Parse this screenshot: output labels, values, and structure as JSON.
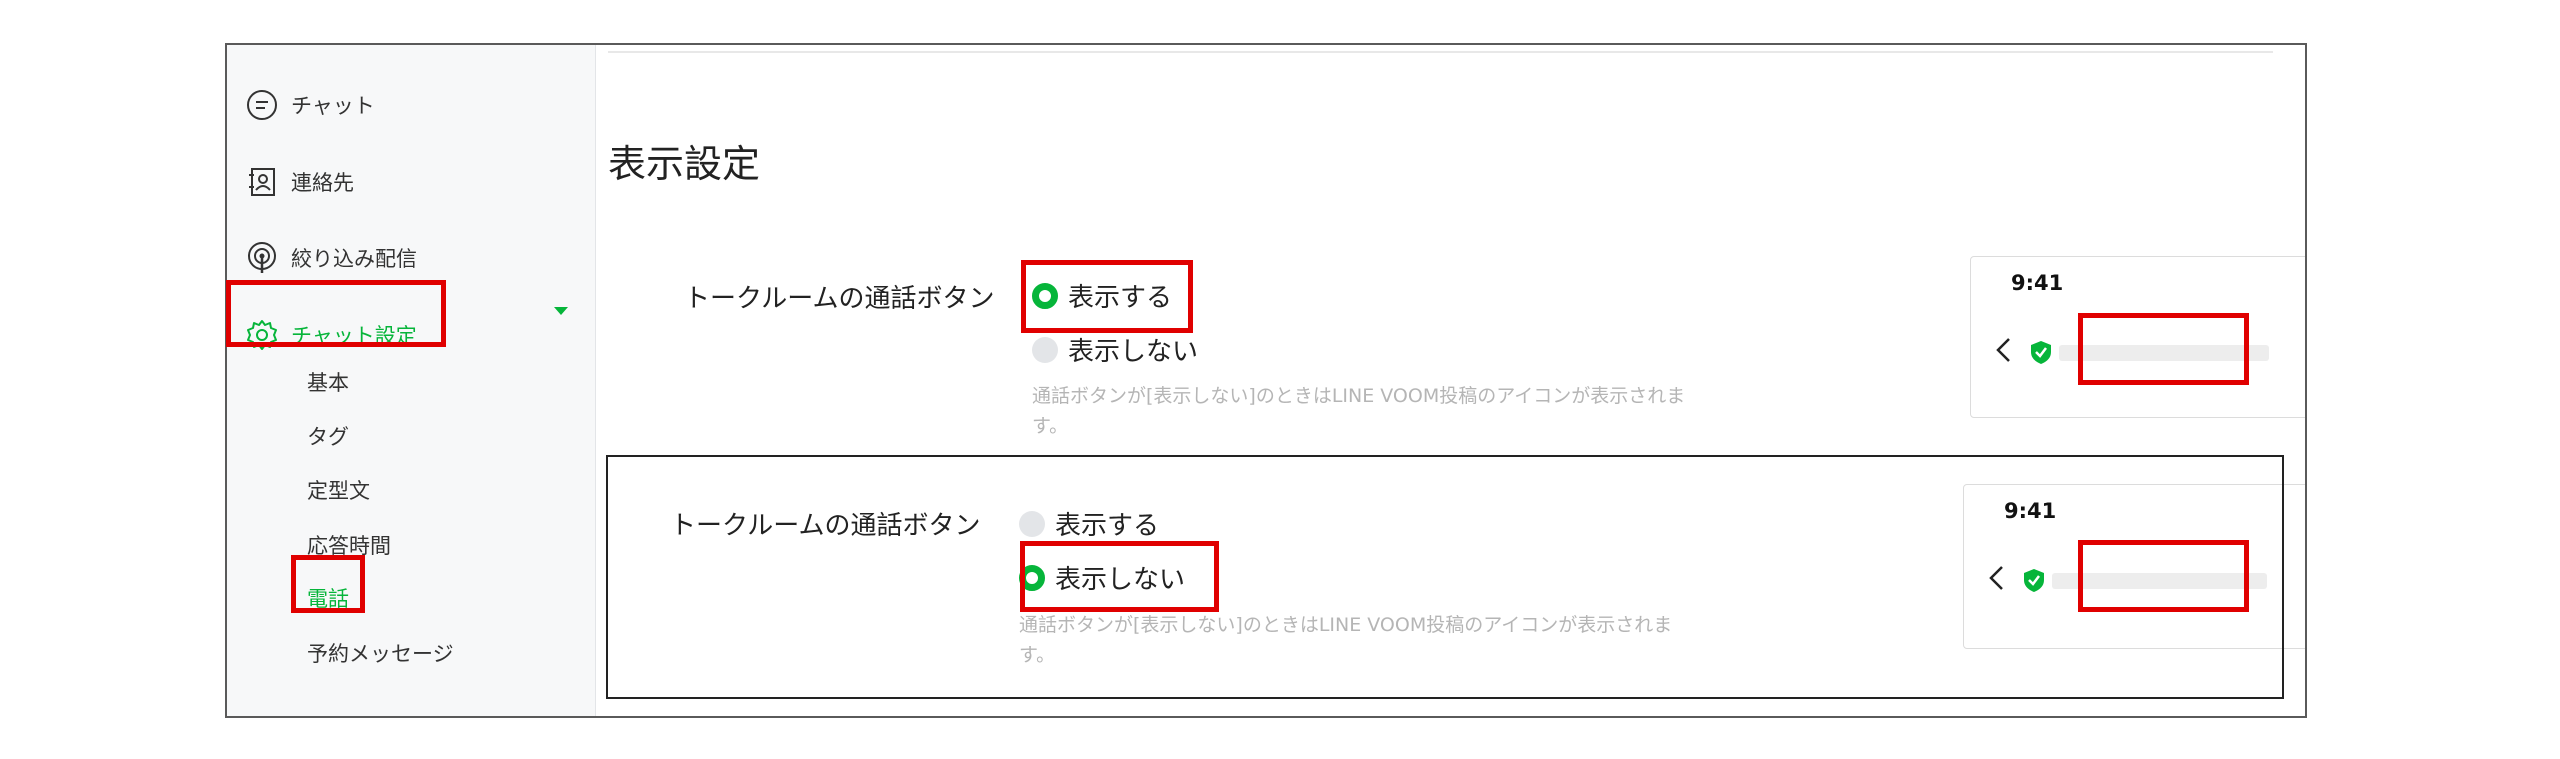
{
  "sidebar": {
    "items": [
      {
        "label": "チャット",
        "icon": "chat-bubble-icon"
      },
      {
        "label": "連絡先",
        "icon": "contact-book-icon"
      },
      {
        "label": "絞り込み配信",
        "icon": "broadcast-icon"
      },
      {
        "label": "チャット設定",
        "icon": "gear-icon",
        "active": true
      }
    ],
    "sub_items": [
      {
        "label": "基本"
      },
      {
        "label": "タグ"
      },
      {
        "label": "定型文"
      },
      {
        "label": "応答時間"
      },
      {
        "label": "電話",
        "active": true
      },
      {
        "label": "予約メッセージ"
      }
    ]
  },
  "main": {
    "title": "表示設定",
    "settings": [
      {
        "label": "トークルームの通話ボタン",
        "options": [
          {
            "label": "表示する",
            "selected": true
          },
          {
            "label": "表示しない",
            "selected": false
          }
        ],
        "note": "通話ボタンが[表示しない]のときはLINE VOOM投稿のアイコンが表示されます。",
        "preview": {
          "time": "9:41",
          "highlight_icon": "phone-icon"
        }
      },
      {
        "label": "トークルームの通話ボタン",
        "options": [
          {
            "label": "表示する",
            "selected": false
          },
          {
            "label": "表示しない",
            "selected": true
          }
        ],
        "note": "通話ボタンが[表示しない]のときはLINE VOOM投稿のアイコンが表示されます。",
        "preview": {
          "time": "9:41",
          "highlight_icon": "voom-post-icon"
        }
      }
    ]
  },
  "colors": {
    "accent": "#06b53a",
    "highlight": "#e00000",
    "icon_bg": "#c9efd4"
  }
}
